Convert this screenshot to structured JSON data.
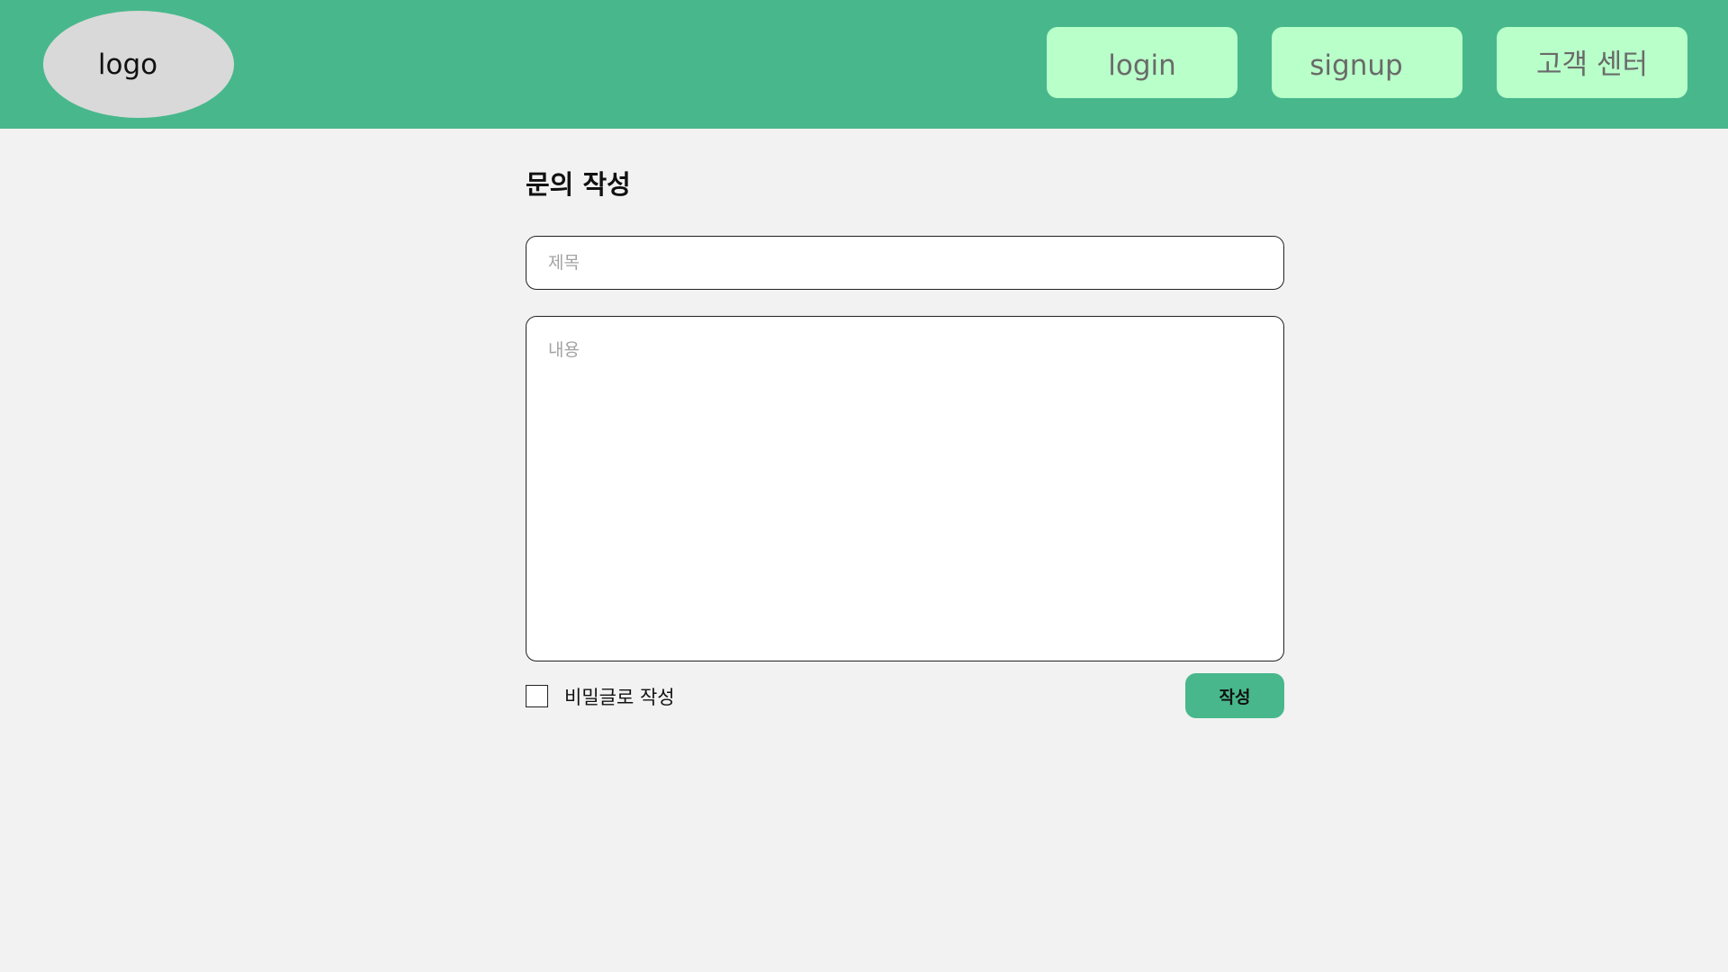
{
  "header": {
    "logo_text": "logo",
    "nav": {
      "login": "login",
      "signup": "signup",
      "support": "고객 센터"
    }
  },
  "form": {
    "title": "문의 작성",
    "subject_placeholder": "제목",
    "subject_value": "",
    "content_placeholder": "내용",
    "content_value": "",
    "secret_label": "비밀글로 작성",
    "secret_checked": false,
    "submit_label": "작성"
  },
  "colors": {
    "header_bg": "#48b88c",
    "nav_button_bg": "#b9ffc9",
    "page_bg": "#f2f2f2",
    "logo_bg": "#d9d9d9",
    "submit_bg": "#48b88c"
  }
}
